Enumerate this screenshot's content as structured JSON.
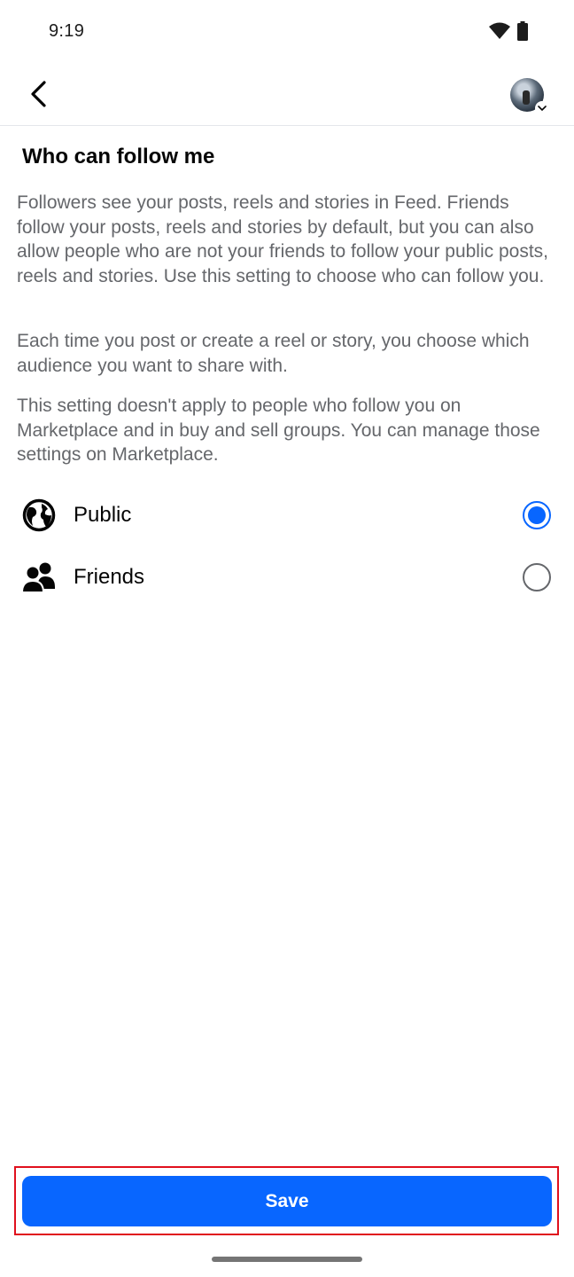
{
  "status_bar": {
    "time": "9:19",
    "icons": [
      "wifi-icon",
      "battery-icon"
    ]
  },
  "header": {
    "back_icon": "chevron-left-icon",
    "avatar_icon": "profile-avatar",
    "avatar_menu_icon": "chevron-down-icon"
  },
  "page": {
    "title": "Who can follow me",
    "paragraphs": [
      "Followers see your posts, reels and stories in Feed. Friends follow your posts, reels and stories by default, but you can also allow people who are not your friends to follow your public posts, reels and stories. Use this setting to choose who can follow you.",
      "Each time you post or create a reel or story, you choose which audience you want to share with.",
      "This setting doesn't apply to people who follow you on Marketplace and in buy and sell groups. You can manage those settings on Marketplace."
    ]
  },
  "options": [
    {
      "label": "Public",
      "icon": "globe-icon",
      "selected": true
    },
    {
      "label": "Friends",
      "icon": "friends-icon",
      "selected": false
    }
  ],
  "footer": {
    "save_label": "Save"
  },
  "colors": {
    "accent": "#0866ff",
    "highlight_border": "#e0101d",
    "secondary_text": "#65676b"
  }
}
